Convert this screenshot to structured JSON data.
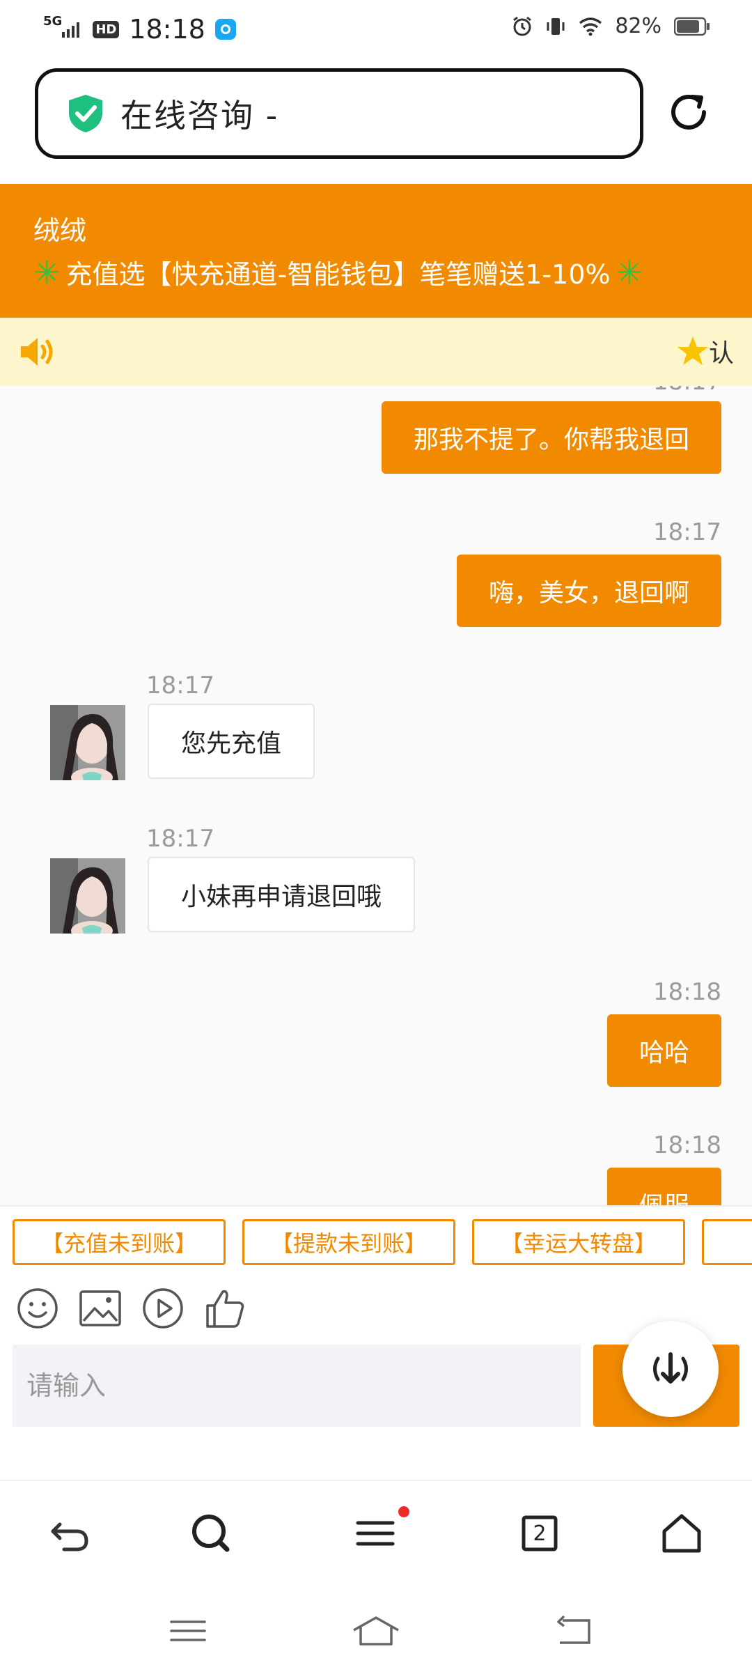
{
  "status_bar": {
    "network": "5G",
    "hd": "HD",
    "time": "18:18",
    "battery": "82%"
  },
  "address_bar": {
    "title": "在线咨询 -"
  },
  "banner": {
    "name": "绒绒",
    "promo": "充值选【快充通道-智能钱包】笔笔赠送1-10%"
  },
  "notice": {
    "right_text": "认"
  },
  "chat": {
    "messages": [
      {
        "dir": "out",
        "time": "",
        "text": "那我不提了。你帮我退回"
      },
      {
        "dir": "out",
        "time": "18:17",
        "text": "嗨，美女，退回啊"
      },
      {
        "dir": "in",
        "time": "18:17",
        "text": "您先充值"
      },
      {
        "dir": "in",
        "time": "18:17",
        "text": "小妹再申请退回哦"
      },
      {
        "dir": "out",
        "time": "18:18",
        "text": "哈哈"
      },
      {
        "dir": "out",
        "time": "18:18",
        "text": "佩服"
      }
    ]
  },
  "quick_buttons": [
    "【充值未到账】",
    "【提款未到账】",
    "【幸运大转盘】"
  ],
  "toolbar_icons": [
    "emoji-icon",
    "image-icon",
    "video-icon",
    "thumbs-up-icon"
  ],
  "input": {
    "placeholder": "请输入"
  },
  "bottom_nav": {
    "tabs_count": "2"
  },
  "colors": {
    "accent": "#f28a00",
    "notice_bg": "#fdf6cd",
    "shield": "#1fc07f"
  }
}
